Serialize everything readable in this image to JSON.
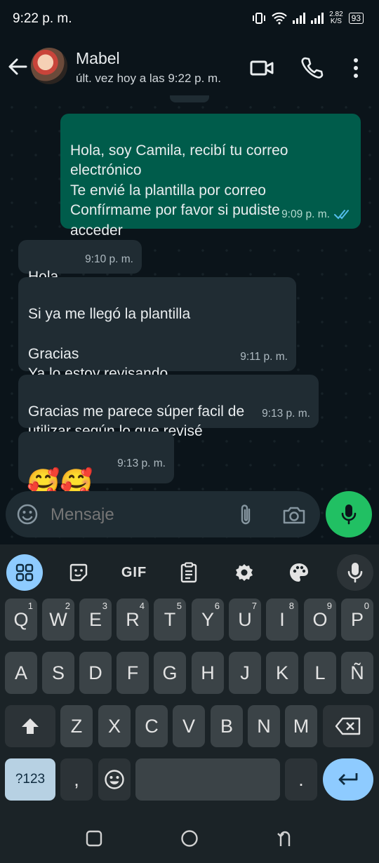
{
  "status_bar": {
    "time": "9:22 p. m.",
    "net_speed": "2.82",
    "net_unit": "K/S",
    "battery": "93"
  },
  "header": {
    "contact_name": "Mabel",
    "last_seen": "últ. vez hoy a las 9:22 p. m."
  },
  "messages": [
    {
      "direction": "out",
      "text": "Hola, soy Camila, recibí tu correo\nelectrónico\nTe envié la plantilla por correo\nConfírmame por favor si pudiste\nacceder",
      "time": "9:09 p. m.",
      "read": true
    },
    {
      "direction": "in",
      "text": "Hola",
      "time": "9:10 p. m."
    },
    {
      "direction": "in",
      "text": "Si ya me llegó la plantilla\n\nGracias\nYa lo estoy revisando",
      "time": "9:11 p. m."
    },
    {
      "direction": "in",
      "text": "Gracias me parece súper facil de\nutilizar según lo que revisé",
      "time": "9:13 p. m."
    },
    {
      "direction": "in",
      "text": "🥰🥰",
      "time": "9:13 p. m."
    }
  ],
  "composer": {
    "placeholder": "Mensaje"
  },
  "keyboard": {
    "toolbar": {
      "gif_label": "GIF"
    },
    "row1": [
      {
        "key": "Q",
        "hint": "1"
      },
      {
        "key": "W",
        "hint": "2"
      },
      {
        "key": "E",
        "hint": "3"
      },
      {
        "key": "R",
        "hint": "4"
      },
      {
        "key": "T",
        "hint": "5"
      },
      {
        "key": "Y",
        "hint": "6"
      },
      {
        "key": "U",
        "hint": "7"
      },
      {
        "key": "I",
        "hint": "8"
      },
      {
        "key": "O",
        "hint": "9"
      },
      {
        "key": "P",
        "hint": "0"
      }
    ],
    "row2": [
      "A",
      "S",
      "D",
      "F",
      "G",
      "H",
      "J",
      "K",
      "L",
      "Ñ"
    ],
    "row3": [
      "Z",
      "X",
      "C",
      "V",
      "B",
      "N",
      "M"
    ],
    "row4": {
      "symbols": "?123",
      "comma": ",",
      "period": "."
    }
  }
}
